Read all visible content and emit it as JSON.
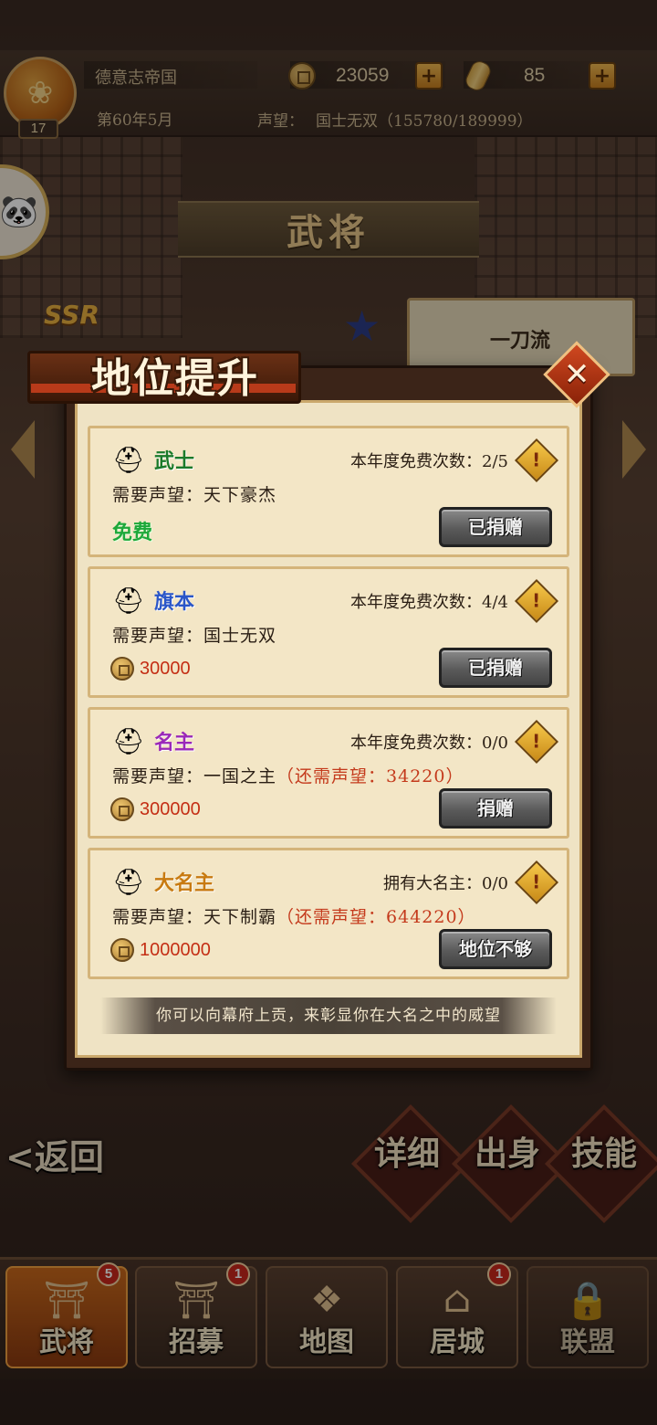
{
  "header": {
    "nation_name": "德意志帝国",
    "level": "17",
    "date": "第60年5月",
    "gold": "23059",
    "rice": "85",
    "prestige_label": "声望：",
    "prestige_value": "国士无双（155780/189999）"
  },
  "scene": {
    "page_title": "武将",
    "rarity": "SSR",
    "skill_name": "一刀流"
  },
  "modal": {
    "title": "地位提升",
    "close_icon": "close-x-icon",
    "ranks": [
      {
        "name": "武士",
        "name_color": "#1a7a2a",
        "quota": "本年度免费次数：2/5",
        "requirement": "需要声望：天下豪杰",
        "requirement_extra": "",
        "cost": "免费",
        "button": "已捐赠"
      },
      {
        "name": "旗本",
        "name_color": "#2a56c8",
        "quota": "本年度免费次数：4/4",
        "requirement": "需要声望：国士无双",
        "requirement_extra": "",
        "cost": "30000",
        "button": "已捐赠"
      },
      {
        "name": "名主",
        "name_color": "#9a28b8",
        "quota": "本年度免费次数：0/0",
        "requirement": "需要声望：一国之主",
        "requirement_extra": "（还需声望：34220）",
        "cost": "300000",
        "button": "捐赠"
      },
      {
        "name": "大名主",
        "name_color": "#c87a10",
        "quota": "拥有大名主：0/0",
        "requirement": "需要声望：天下制霸",
        "requirement_extra": "（还需声望：644220）",
        "cost": "1000000",
        "button": "地位不够"
      }
    ],
    "footer": "你可以向幕府上贡，来彰显你在大名之中的威望"
  },
  "actions": {
    "back": "<返回",
    "detail": "详细",
    "origin": "出身",
    "skill": "技能"
  },
  "tabs": [
    {
      "label": "武将",
      "badge": "5",
      "active": true
    },
    {
      "label": "招募",
      "badge": "1",
      "active": false
    },
    {
      "label": "地图",
      "badge": "",
      "active": false
    },
    {
      "label": "居城",
      "badge": "1",
      "active": false
    },
    {
      "label": "联盟",
      "badge": "",
      "active": false
    }
  ]
}
